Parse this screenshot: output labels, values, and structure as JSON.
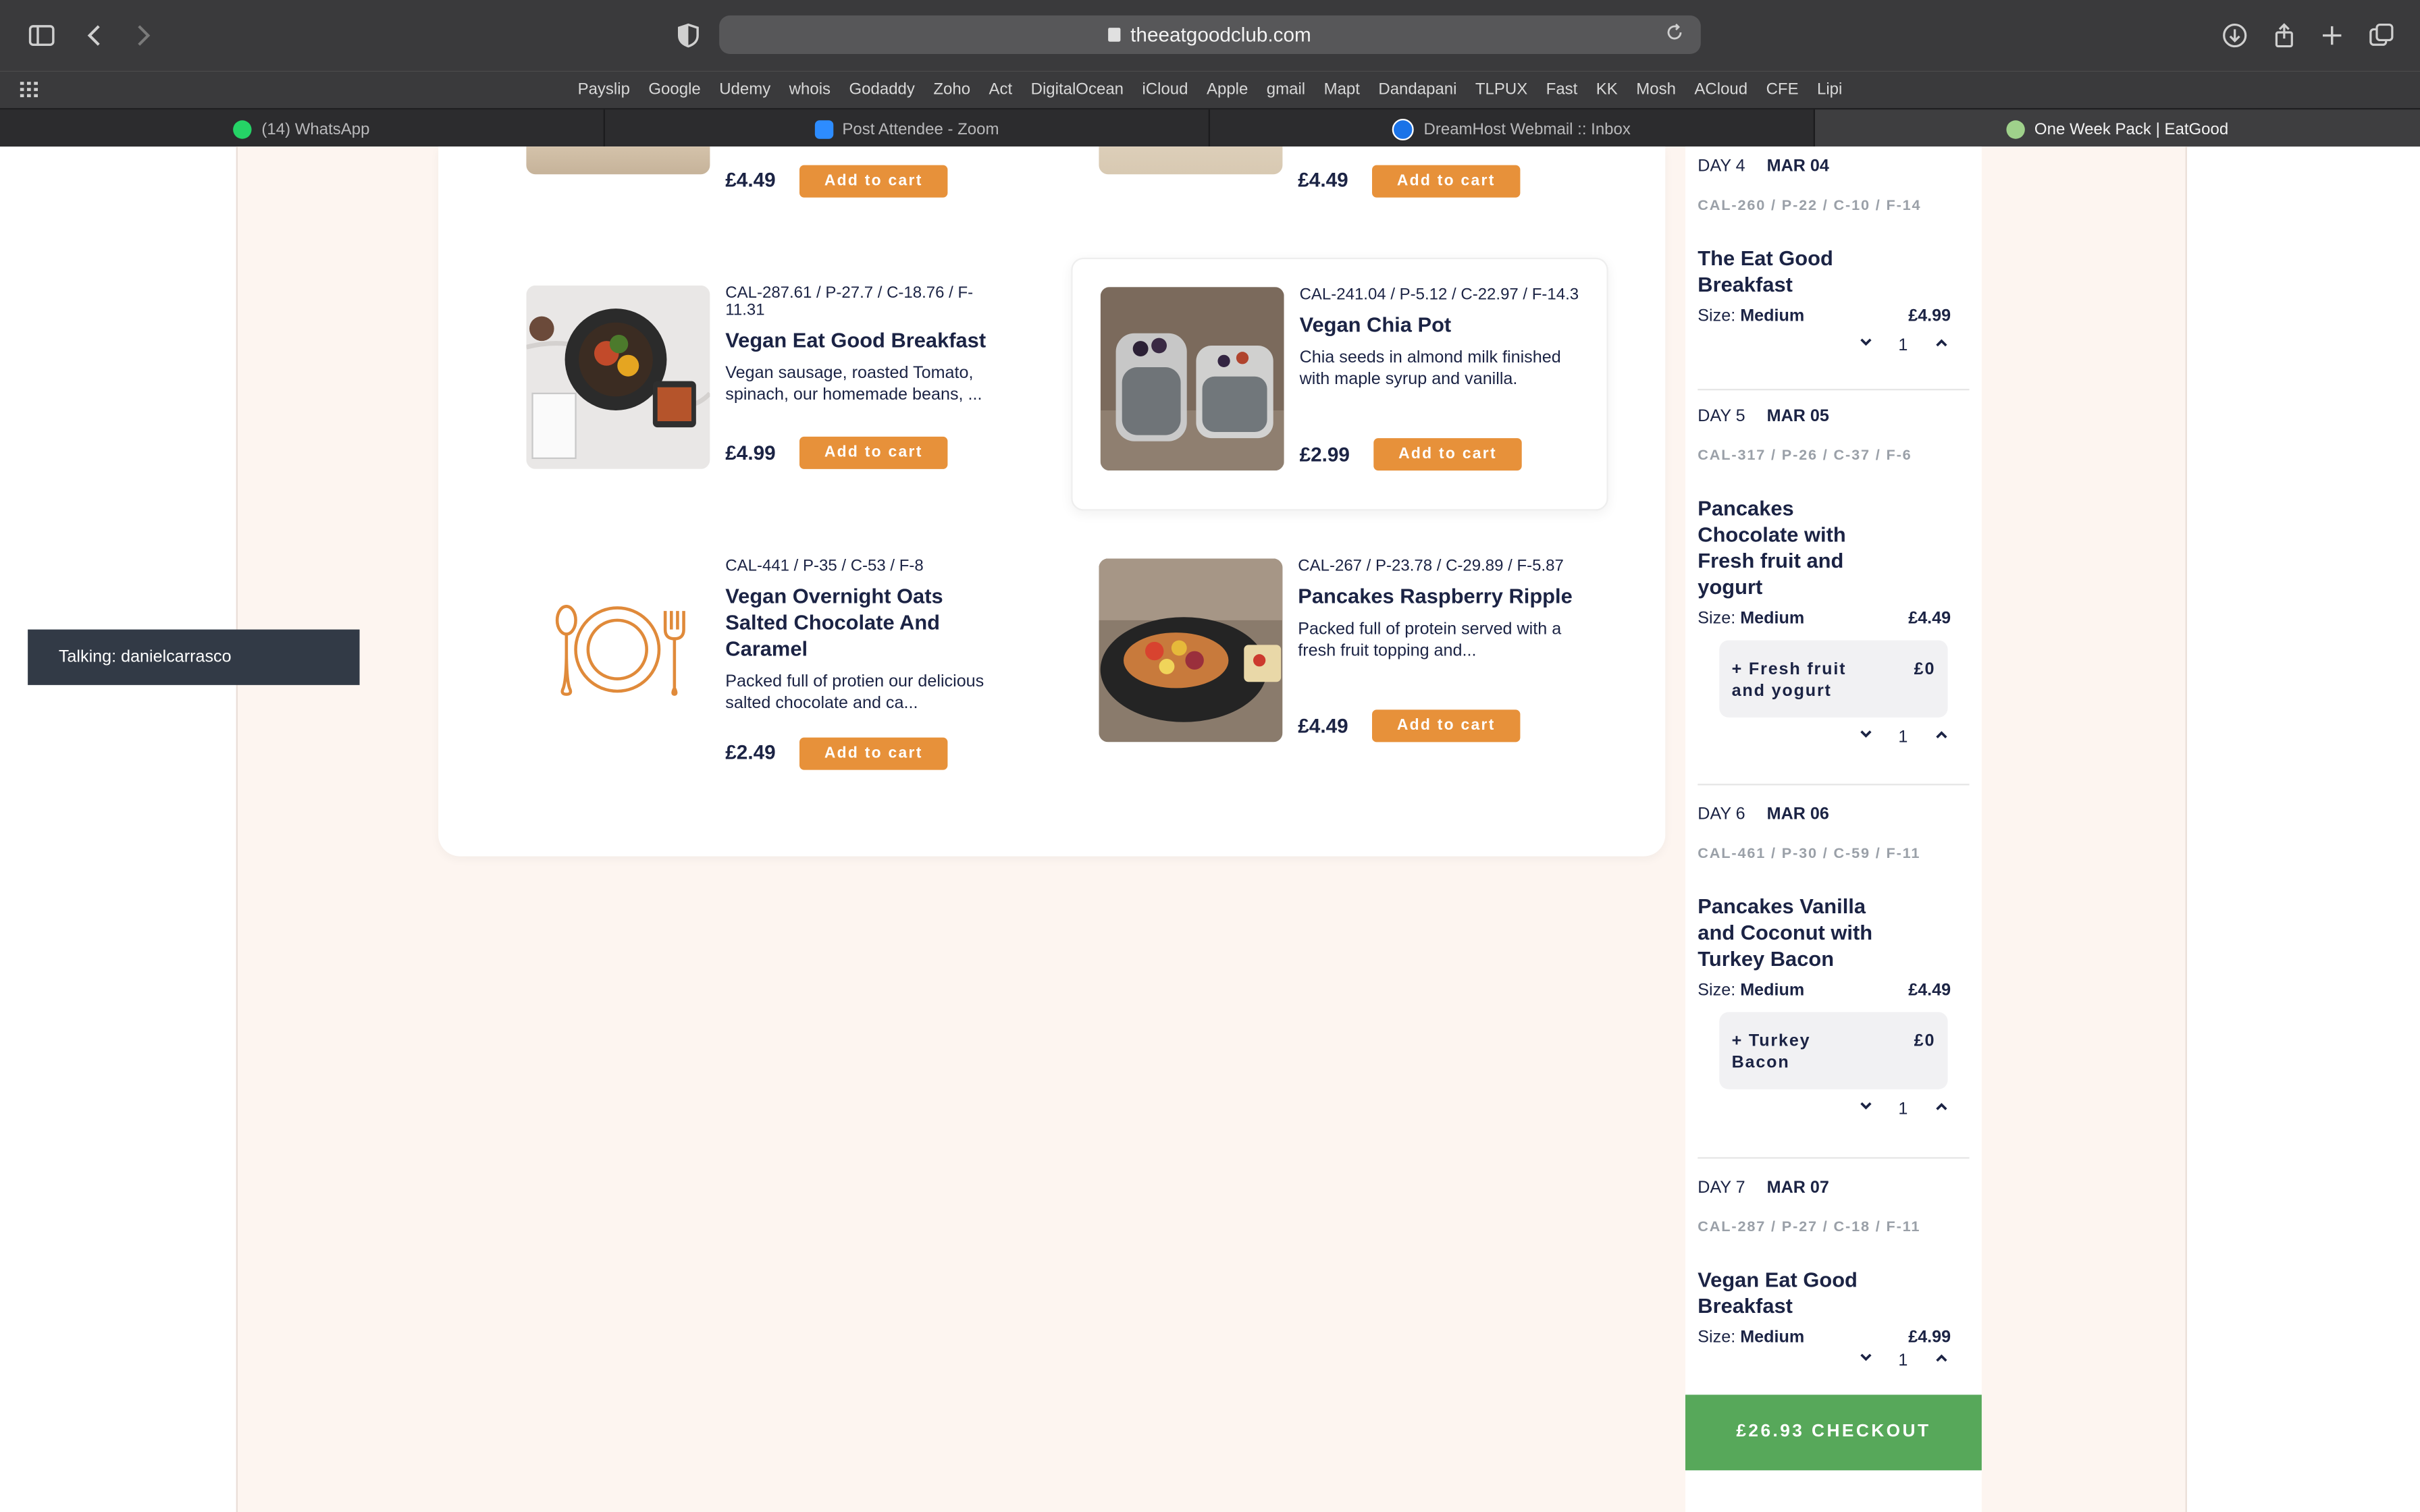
{
  "browser": {
    "url": "theeatgoodclub.com",
    "bookmarks": [
      "Payslip",
      "Google",
      "Udemy",
      "whois",
      "Godaddy",
      "Zoho",
      "Act",
      "DigitalOcean",
      "iCloud",
      "Apple",
      "gmail",
      "Mapt",
      "Dandapani",
      "TLPUX",
      "Fast",
      "KK",
      "Mosh",
      "ACloud",
      "CFE",
      "Lipi"
    ],
    "tabs": [
      {
        "label": "(14) WhatsApp",
        "icon": "whatsapp-icon",
        "color": "#25d366"
      },
      {
        "label": "Post Attendee - Zoom",
        "icon": "zoom-icon",
        "color": "#2d8cff"
      },
      {
        "label": "DreamHost Webmail :: Inbox",
        "icon": "dreamhost-icon",
        "color": "#1a73e8"
      },
      {
        "label": "One Week Pack | EatGood",
        "icon": "eatgood-icon",
        "color": "#9fd18b"
      }
    ]
  },
  "products": [
    {
      "price": "£4.49",
      "cart": "Add to cart"
    },
    {
      "price": "£4.49",
      "cart": "Add to cart"
    },
    {
      "macros": "CAL-287.61 / P-27.7 / C-18.76 / F-11.31",
      "name": "Vegan Eat Good Breakfast",
      "desc": "Vegan sausage, roasted Tomato, spinach, our homemade beans, ...",
      "price": "£4.99",
      "cart": "Add to cart"
    },
    {
      "macros": "CAL-241.04 / P-5.12 / C-22.97 / F-14.3",
      "name": "Vegan Chia Pot",
      "desc": "Chia seeds in almond milk finished with maple syrup and vanilla.",
      "price": "£2.99",
      "cart": "Add to cart"
    },
    {
      "macros": "CAL-441 / P-35 / C-53 / F-8",
      "name": "Vegan Overnight Oats Salted Chocolate And Caramel",
      "desc": "Packed full of protien our delicious salted chocolate and ca...",
      "price": "£2.49",
      "cart": "Add to cart"
    },
    {
      "macros": "CAL-267 / P-23.78 / C-29.89 / F-5.87",
      "name": "Pancakes Raspberry Ripple",
      "desc": "Packed full of protein served with a fresh fruit topping and...",
      "price": "£4.49",
      "cart": "Add to cart"
    }
  ],
  "sidebar": {
    "days": [
      {
        "day": "DAY 4",
        "date": "MAR 04",
        "macros": "CAL-260 / P-22 / C-10 / F-14",
        "name": "The Eat Good Breakfast",
        "size_label": "Size:",
        "size": "Medium",
        "price": "£4.99",
        "qty": "1"
      },
      {
        "day": "DAY 5",
        "date": "MAR 05",
        "macros": "CAL-317 / P-26 / C-37 / F-6",
        "name": "Pancakes Chocolate with Fresh fruit and yogurt",
        "size_label": "Size:",
        "size": "Medium",
        "price": "£4.49",
        "extra": "+ Fresh fruit and yogurt",
        "extra_price": "£0",
        "qty": "1"
      },
      {
        "day": "DAY 6",
        "date": "MAR 06",
        "macros": "CAL-461 / P-30 / C-59 / F-11",
        "name": "Pancakes Vanilla and Coconut with Turkey Bacon",
        "size_label": "Size:",
        "size": "Medium",
        "price": "£4.49",
        "extra": "+ Turkey Bacon",
        "extra_price": "£0",
        "qty": "1"
      },
      {
        "day": "DAY 7",
        "date": "MAR 07",
        "macros": "CAL-287 / P-27 / C-18 / F-11",
        "name": "Vegan Eat Good Breakfast",
        "size_label": "Size:",
        "size": "Medium",
        "price": "£4.99",
        "qty": "1"
      }
    ],
    "checkout": "£26.93  CHECKOUT"
  },
  "overlay": {
    "talking": "Talking: danielcarrasco"
  }
}
